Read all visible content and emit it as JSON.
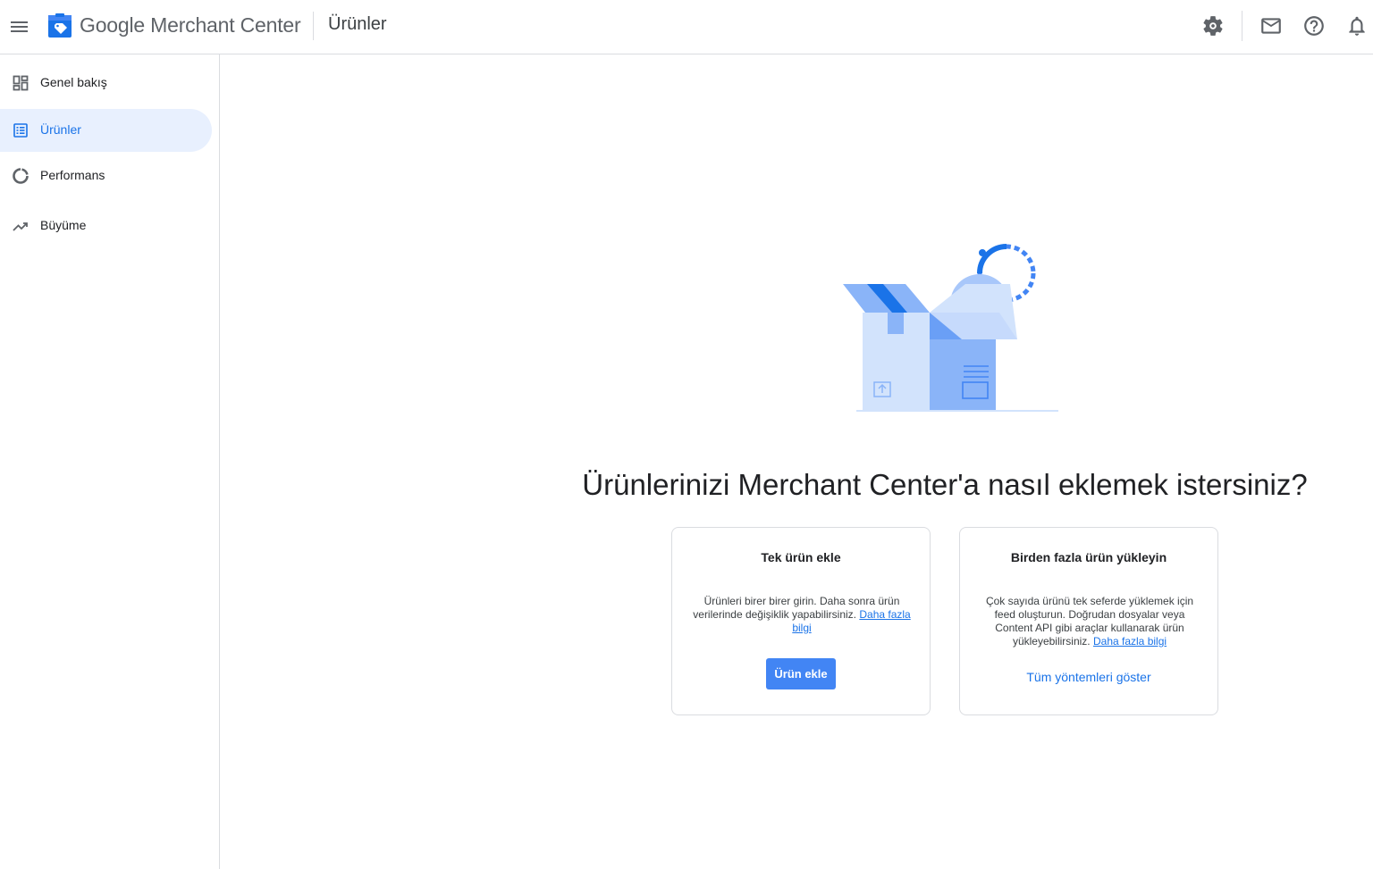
{
  "header": {
    "brand": "Google Merchant Center",
    "page_title": "Ürünler"
  },
  "sidebar": {
    "items": [
      {
        "label": "Genel bakış",
        "icon": "dashboard-icon"
      },
      {
        "label": "Ürünler",
        "icon": "list-icon",
        "active": true
      },
      {
        "label": "Performans",
        "icon": "donut-icon"
      },
      {
        "label": "Büyüme",
        "icon": "trending-up-icon"
      }
    ]
  },
  "main": {
    "headline": "Ürünlerinizi Merchant Center'a nasıl eklemek istersiniz?",
    "cards": [
      {
        "title": "Tek ürün ekle",
        "description": "Ürünleri birer birer girin. Daha sonra ürün verilerinde değişiklik yapabilirsiniz.",
        "link": "Daha fazla bilgi",
        "button": "Ürün ekle"
      },
      {
        "title": "Birden fazla ürün yükleyin",
        "description": "Çok sayıda ürünü tek seferde yüklemek için feed oluşturun. Doğrudan dosyalar veya Content API gibi araçlar kullanarak ürün yükleyebilirsiniz.",
        "link": "Daha fazla bilgi",
        "action": "Tüm yöntemleri göster"
      }
    ]
  },
  "colors": {
    "accent": "#1a73e8",
    "button": "#4285f4",
    "active_nav_bg": "#e8f0fe"
  }
}
